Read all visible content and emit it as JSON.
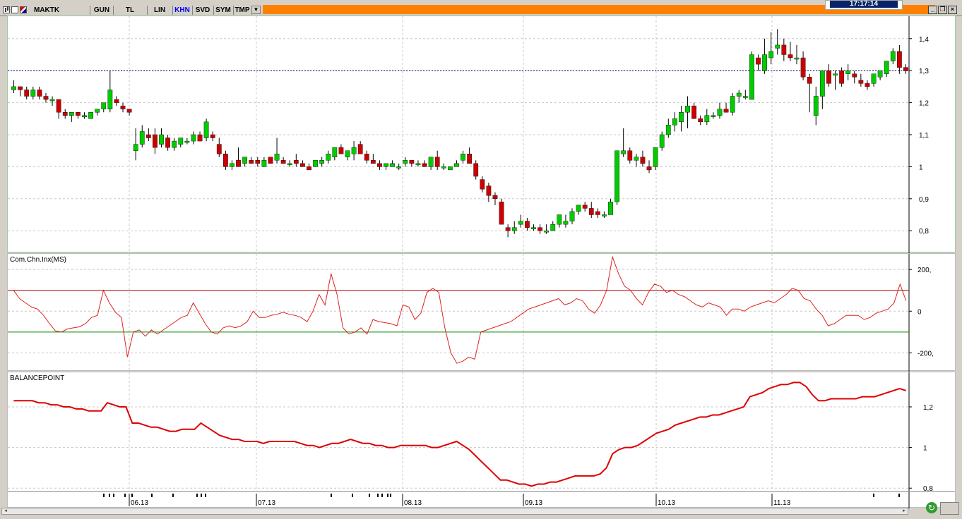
{
  "toolbar": {
    "symbol": "MAKTK",
    "buttons": [
      "GUN",
      "TL",
      "LIN",
      "KHN",
      "SVD",
      "SYM",
      "TMP"
    ],
    "active": "KHN",
    "clock": "17:17:14"
  },
  "colors": {
    "up": "#00cc00",
    "down": "#cc0000",
    "cci_line": "#dd2222",
    "upper_band": "#aa0000",
    "lower_band": "#008800",
    "balance_line": "#dd0000",
    "ref_line": "#000080"
  },
  "chart_data": [
    {
      "type": "candlestick",
      "name": "price",
      "ylim": [
        0.73,
        1.47
      ],
      "yticks": [
        "1,4",
        "1,3",
        "1,2",
        "1,1",
        "1",
        "0,9",
        "0,8"
      ],
      "ytick_values": [
        1.4,
        1.3,
        1.2,
        1.1,
        1.0,
        0.9,
        0.8
      ],
      "ref_line": 1.3,
      "candles": [
        [
          1.24,
          1.27,
          1.23,
          1.25
        ],
        [
          1.25,
          1.25,
          1.22,
          1.24
        ],
        [
          1.24,
          1.25,
          1.21,
          1.22
        ],
        [
          1.22,
          1.25,
          1.21,
          1.24
        ],
        [
          1.24,
          1.25,
          1.21,
          1.22
        ],
        [
          1.22,
          1.23,
          1.2,
          1.21
        ],
        [
          1.21,
          1.22,
          1.19,
          1.21
        ],
        [
          1.21,
          1.21,
          1.15,
          1.17
        ],
        [
          1.17,
          1.18,
          1.15,
          1.16
        ],
        [
          1.16,
          1.17,
          1.14,
          1.17
        ],
        [
          1.17,
          1.17,
          1.15,
          1.16
        ],
        [
          1.16,
          1.17,
          1.15,
          1.16
        ],
        [
          1.15,
          1.17,
          1.15,
          1.17
        ],
        [
          1.17,
          1.18,
          1.16,
          1.18
        ],
        [
          1.18,
          1.2,
          1.17,
          1.2
        ],
        [
          1.18,
          1.3,
          1.17,
          1.24
        ],
        [
          1.21,
          1.22,
          1.19,
          1.2
        ],
        [
          1.19,
          1.2,
          1.17,
          1.18
        ],
        [
          1.18,
          1.18,
          1.16,
          1.17
        ],
        [
          1.05,
          1.12,
          1.02,
          1.07
        ],
        [
          1.07,
          1.13,
          1.06,
          1.11
        ],
        [
          1.1,
          1.12,
          1.08,
          1.09
        ],
        [
          1.1,
          1.12,
          1.04,
          1.06
        ],
        [
          1.07,
          1.12,
          1.06,
          1.1
        ],
        [
          1.09,
          1.1,
          1.05,
          1.06
        ],
        [
          1.06,
          1.09,
          1.05,
          1.08
        ],
        [
          1.07,
          1.09,
          1.06,
          1.09
        ],
        [
          1.08,
          1.09,
          1.07,
          1.08
        ],
        [
          1.08,
          1.11,
          1.07,
          1.1
        ],
        [
          1.1,
          1.11,
          1.08,
          1.08
        ],
        [
          1.09,
          1.15,
          1.08,
          1.14
        ],
        [
          1.1,
          1.11,
          1.08,
          1.09
        ],
        [
          1.07,
          1.09,
          1.03,
          1.04
        ],
        [
          1.04,
          1.05,
          0.99,
          1.0
        ],
        [
          1.0,
          1.02,
          0.99,
          1.01
        ],
        [
          1.02,
          1.06,
          1.0,
          1.0
        ],
        [
          1.01,
          1.03,
          1.0,
          1.03
        ],
        [
          1.02,
          1.03,
          1.01,
          1.01
        ],
        [
          1.02,
          1.03,
          1.0,
          1.01
        ],
        [
          1.0,
          1.03,
          1.0,
          1.02
        ],
        [
          1.03,
          1.03,
          1.01,
          1.01
        ],
        [
          1.02,
          1.09,
          1.01,
          1.04
        ],
        [
          1.02,
          1.03,
          1.01,
          1.01
        ],
        [
          1.01,
          1.02,
          1.0,
          1.01
        ],
        [
          1.02,
          1.04,
          1.0,
          1.01
        ],
        [
          1.01,
          1.02,
          1.0,
          1.0
        ],
        [
          1.0,
          1.01,
          0.99,
          0.99
        ],
        [
          1.0,
          1.02,
          1.0,
          1.02
        ],
        [
          1.01,
          1.03,
          1.0,
          1.02
        ],
        [
          1.02,
          1.05,
          1.01,
          1.04
        ],
        [
          1.03,
          1.05,
          1.02,
          1.06
        ],
        [
          1.06,
          1.07,
          1.05,
          1.04
        ],
        [
          1.03,
          1.05,
          1.02,
          1.05
        ],
        [
          1.04,
          1.08,
          1.02,
          1.06
        ],
        [
          1.07,
          1.08,
          1.04,
          1.04
        ],
        [
          1.04,
          1.05,
          1.01,
          1.02
        ],
        [
          1.02,
          1.04,
          1.01,
          1.01
        ],
        [
          1.01,
          1.02,
          0.99,
          1.0
        ],
        [
          1.0,
          1.01,
          0.99,
          1.01
        ],
        [
          1.0,
          1.02,
          1.0,
          1.01
        ],
        [
          1.0,
          1.01,
          0.99,
          1.0
        ],
        [
          1.01,
          1.03,
          1.0,
          1.02
        ],
        [
          1.02,
          1.02,
          1.0,
          1.01
        ],
        [
          1.01,
          1.02,
          1.0,
          1.01
        ],
        [
          1.01,
          1.02,
          1.0,
          1.0
        ],
        [
          1.0,
          1.03,
          0.99,
          1.03
        ],
        [
          1.03,
          1.05,
          0.99,
          1.0
        ],
        [
          1.0,
          1.01,
          0.99,
          1.0
        ],
        [
          0.99,
          1.0,
          0.99,
          1.0
        ],
        [
          1.0,
          1.02,
          1.0,
          1.01
        ],
        [
          1.02,
          1.05,
          1.01,
          1.04
        ],
        [
          1.04,
          1.06,
          1.03,
          1.01
        ],
        [
          1.01,
          1.02,
          0.96,
          0.97
        ],
        [
          0.96,
          0.97,
          0.92,
          0.93
        ],
        [
          0.94,
          0.95,
          0.89,
          0.91
        ],
        [
          0.91,
          0.92,
          0.88,
          0.9
        ],
        [
          0.89,
          0.9,
          0.82,
          0.82
        ],
        [
          0.81,
          0.82,
          0.78,
          0.8
        ],
        [
          0.8,
          0.83,
          0.79,
          0.81
        ],
        [
          0.82,
          0.85,
          0.81,
          0.83
        ],
        [
          0.83,
          0.84,
          0.8,
          0.81
        ],
        [
          0.81,
          0.82,
          0.8,
          0.81
        ],
        [
          0.81,
          0.82,
          0.79,
          0.8
        ],
        [
          0.8,
          0.82,
          0.79,
          0.8
        ],
        [
          0.8,
          0.83,
          0.8,
          0.82
        ],
        [
          0.82,
          0.85,
          0.81,
          0.85
        ],
        [
          0.82,
          0.85,
          0.81,
          0.83
        ],
        [
          0.83,
          0.87,
          0.82,
          0.86
        ],
        [
          0.86,
          0.88,
          0.85,
          0.88
        ],
        [
          0.88,
          0.89,
          0.86,
          0.87
        ],
        [
          0.87,
          0.89,
          0.84,
          0.85
        ],
        [
          0.86,
          0.87,
          0.84,
          0.85
        ],
        [
          0.85,
          0.86,
          0.84,
          0.85
        ],
        [
          0.85,
          0.9,
          0.85,
          0.89
        ],
        [
          0.89,
          1.05,
          0.88,
          1.05
        ],
        [
          1.04,
          1.12,
          1.03,
          1.05
        ],
        [
          1.05,
          1.06,
          1.01,
          1.02
        ],
        [
          1.02,
          1.04,
          1.0,
          1.03
        ],
        [
          1.03,
          1.05,
          1.0,
          1.01
        ],
        [
          1.0,
          1.02,
          0.98,
          0.99
        ],
        [
          1.0,
          1.06,
          0.99,
          1.06
        ],
        [
          1.06,
          1.11,
          1.05,
          1.1
        ],
        [
          1.1,
          1.15,
          1.09,
          1.13
        ],
        [
          1.13,
          1.17,
          1.11,
          1.15
        ],
        [
          1.14,
          1.19,
          1.11,
          1.17
        ],
        [
          1.17,
          1.22,
          1.12,
          1.19
        ],
        [
          1.19,
          1.2,
          1.15,
          1.15
        ],
        [
          1.15,
          1.16,
          1.13,
          1.14
        ],
        [
          1.14,
          1.18,
          1.13,
          1.16
        ],
        [
          1.16,
          1.17,
          1.15,
          1.16
        ],
        [
          1.16,
          1.2,
          1.15,
          1.18
        ],
        [
          1.18,
          1.2,
          1.17,
          1.17
        ],
        [
          1.17,
          1.23,
          1.16,
          1.22
        ],
        [
          1.22,
          1.24,
          1.2,
          1.23
        ],
        [
          1.22,
          1.24,
          1.21,
          1.22
        ],
        [
          1.21,
          1.36,
          1.21,
          1.35
        ],
        [
          1.34,
          1.35,
          1.3,
          1.32
        ],
        [
          1.3,
          1.4,
          1.29,
          1.35
        ],
        [
          1.34,
          1.42,
          1.32,
          1.36
        ],
        [
          1.37,
          1.43,
          1.35,
          1.38
        ],
        [
          1.38,
          1.4,
          1.33,
          1.35
        ],
        [
          1.35,
          1.39,
          1.33,
          1.34
        ],
        [
          1.34,
          1.38,
          1.32,
          1.34
        ],
        [
          1.34,
          1.36,
          1.27,
          1.28
        ],
        [
          1.28,
          1.29,
          1.17,
          1.26
        ],
        [
          1.16,
          1.25,
          1.13,
          1.22
        ],
        [
          1.22,
          1.27,
          1.18,
          1.3
        ],
        [
          1.3,
          1.32,
          1.25,
          1.26
        ],
        [
          1.29,
          1.3,
          1.24,
          1.29
        ],
        [
          1.3,
          1.31,
          1.25,
          1.26
        ],
        [
          1.29,
          1.32,
          1.27,
          1.3
        ],
        [
          1.29,
          1.3,
          1.26,
          1.28
        ],
        [
          1.27,
          1.29,
          1.25,
          1.26
        ],
        [
          1.26,
          1.27,
          1.24,
          1.25
        ],
        [
          1.26,
          1.29,
          1.25,
          1.29
        ],
        [
          1.28,
          1.3,
          1.27,
          1.3
        ],
        [
          1.29,
          1.33,
          1.28,
          1.33
        ],
        [
          1.33,
          1.37,
          1.32,
          1.36
        ],
        [
          1.36,
          1.38,
          1.29,
          1.31
        ],
        [
          1.31,
          1.32,
          1.29,
          1.3
        ]
      ]
    },
    {
      "type": "line",
      "name": "Com.Chn.Inx(MS)",
      "ylim": [
        -290,
        275
      ],
      "yticks": [
        "200,",
        "0",
        "-200,"
      ],
      "ytick_values": [
        200,
        0,
        -200
      ],
      "bands": [
        100,
        -100
      ],
      "values": [
        100,
        60,
        40,
        20,
        10,
        -20,
        -60,
        -95,
        -100,
        -85,
        -80,
        -75,
        -60,
        -30,
        -20,
        100,
        40,
        -5,
        -30,
        -220,
        -100,
        -90,
        -120,
        -90,
        -110,
        -90,
        -70,
        -50,
        -30,
        -20,
        40,
        -10,
        -60,
        -100,
        -110,
        -80,
        -70,
        -80,
        -70,
        -50,
        0,
        -30,
        -30,
        -20,
        -15,
        -5,
        -15,
        -20,
        -30,
        -50,
        0,
        80,
        30,
        180,
        80,
        -80,
        -110,
        -100,
        -80,
        -110,
        -40,
        -50,
        -55,
        -60,
        -70,
        30,
        20,
        -40,
        -10,
        90,
        110,
        90,
        -80,
        -200,
        -250,
        -240,
        -220,
        -230,
        -100,
        -90,
        -80,
        -70,
        -60,
        -50,
        -30,
        -10,
        10,
        20,
        30,
        40,
        50,
        60,
        30,
        40,
        60,
        50,
        10,
        -10,
        30,
        100,
        260,
        180,
        120,
        100,
        60,
        30,
        90,
        130,
        120,
        90,
        100,
        80,
        70,
        50,
        30,
        20,
        40,
        30,
        20,
        -20,
        10,
        10,
        0,
        20,
        30,
        40,
        50,
        40,
        60,
        80,
        110,
        100,
        60,
        50,
        10,
        -20,
        -70,
        -60,
        -40,
        -20,
        -20,
        -20,
        -40,
        -30,
        -10,
        0,
        10,
        40,
        130,
        50
      ]
    },
    {
      "type": "line",
      "name": "BALANCEPOINT",
      "ylim": [
        0.78,
        1.37
      ],
      "yticks": [
        "1,2",
        "1",
        "0,8"
      ],
      "ytick_values": [
        1.2,
        1.0,
        0.8
      ],
      "values": [
        1.23,
        1.23,
        1.23,
        1.23,
        1.22,
        1.22,
        1.21,
        1.21,
        1.2,
        1.2,
        1.19,
        1.19,
        1.18,
        1.18,
        1.18,
        1.22,
        1.21,
        1.2,
        1.2,
        1.12,
        1.12,
        1.11,
        1.1,
        1.1,
        1.09,
        1.08,
        1.08,
        1.09,
        1.09,
        1.09,
        1.12,
        1.1,
        1.08,
        1.06,
        1.05,
        1.04,
        1.04,
        1.03,
        1.03,
        1.03,
        1.02,
        1.03,
        1.03,
        1.03,
        1.03,
        1.03,
        1.02,
        1.01,
        1.01,
        1.0,
        1.01,
        1.02,
        1.02,
        1.03,
        1.04,
        1.03,
        1.02,
        1.02,
        1.01,
        1.01,
        1.0,
        1.0,
        1.01,
        1.01,
        1.01,
        1.01,
        1.01,
        1.0,
        1.0,
        1.01,
        1.02,
        1.03,
        1.01,
        0.99,
        0.96,
        0.93,
        0.9,
        0.87,
        0.84,
        0.84,
        0.83,
        0.82,
        0.82,
        0.81,
        0.82,
        0.82,
        0.83,
        0.83,
        0.84,
        0.85,
        0.86,
        0.86,
        0.86,
        0.86,
        0.87,
        0.9,
        0.97,
        0.99,
        1.0,
        1.0,
        1.01,
        1.03,
        1.05,
        1.07,
        1.08,
        1.09,
        1.11,
        1.12,
        1.13,
        1.14,
        1.15,
        1.15,
        1.16,
        1.16,
        1.17,
        1.18,
        1.19,
        1.2,
        1.25,
        1.26,
        1.27,
        1.29,
        1.3,
        1.31,
        1.31,
        1.32,
        1.32,
        1.3,
        1.26,
        1.23,
        1.23,
        1.24,
        1.24,
        1.24,
        1.24,
        1.24,
        1.25,
        1.25,
        1.25,
        1.26,
        1.27,
        1.28,
        1.29,
        1.28
      ]
    }
  ],
  "date_axis": {
    "labels": [
      "06.13",
      "07.13",
      "08.13",
      "09.13",
      "10.13",
      "11.13"
    ]
  }
}
